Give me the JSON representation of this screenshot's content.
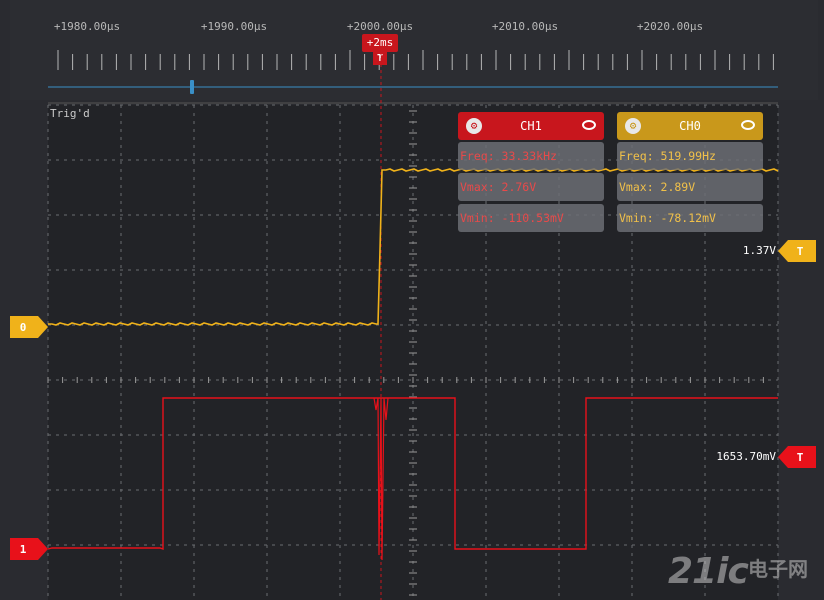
{
  "time_axis": {
    "labels": [
      "+1980.00µs",
      "+1990.00µs",
      "+2000.00µs",
      "+2010.00µs",
      "+2020.00µs"
    ],
    "offset_label": "+2ms",
    "trigger_glyph": "T"
  },
  "status": {
    "trigger_state": "Trig'd"
  },
  "ch1_panel": {
    "title": "CH1",
    "freq": "Freq: 33.33kHz",
    "vmax": "Vmax: 2.76V",
    "vmin": "Vmin: -110.53mV"
  },
  "ch0_panel": {
    "title": "CH0",
    "freq": "Freq: 519.99Hz",
    "vmax": "Vmax: 2.89V",
    "vmin": "Vmin: -78.12mV"
  },
  "markers": {
    "ch0_ground": "0",
    "ch1_ground": "1",
    "ch0_trigger_level": "1.37V",
    "ch1_trigger_level": "1653.70mV",
    "trigger_tag": "T"
  },
  "watermark": {
    "brand": "21ic",
    "site": "电子网"
  },
  "colors": {
    "ch0": "#f0b21a",
    "ch1": "#e8111a",
    "ch1_panel": "#c8161d",
    "ch0_panel": "#c9981b",
    "grid": "#6a6c70",
    "background": "#222327"
  }
}
